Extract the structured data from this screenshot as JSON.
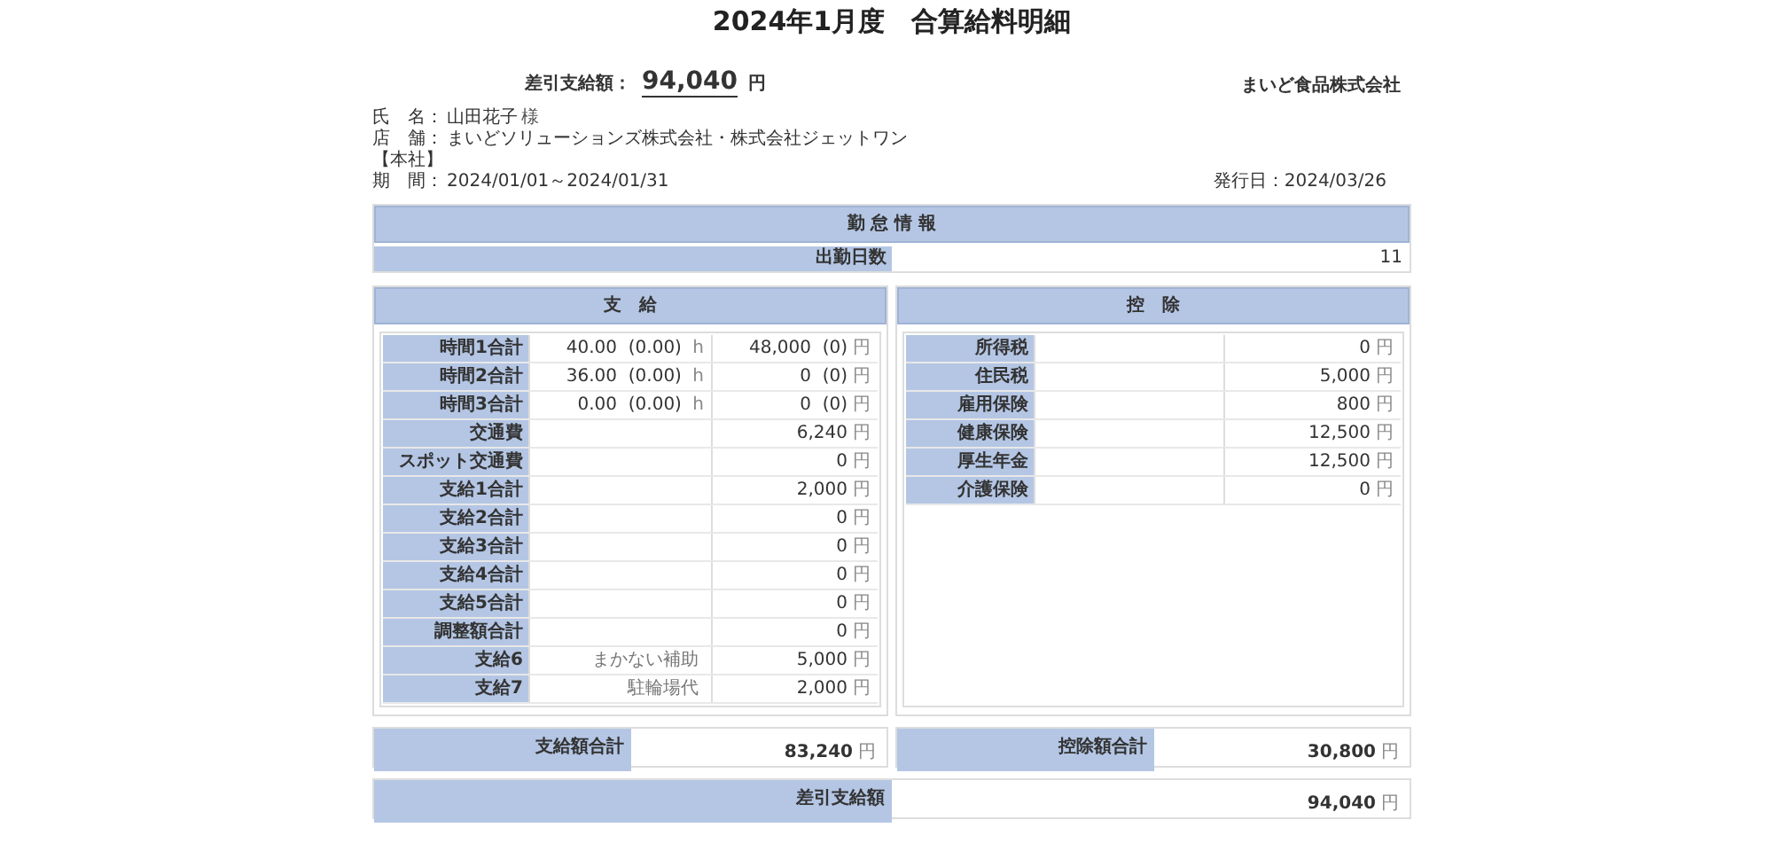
{
  "title": "2024年1月度　合算給料明細",
  "summary": {
    "label": "差引支給額：",
    "amount": "94,040",
    "unit": "円",
    "company": "まいど食品株式会社"
  },
  "info": {
    "name_label": "氏　名：",
    "name": "山田花子",
    "honorific": "様",
    "store_label": "店　舗：",
    "store": "まいどソリューションズ株式会社・株式会社ジェットワン",
    "branch": "【本社】",
    "period_label": "期　間：",
    "period": "2024/01/01～2024/01/31",
    "issued": "発行日：2024/03/26"
  },
  "attendance": {
    "title": "勤 怠 情 報",
    "rows": [
      {
        "label": "出勤日数",
        "value": "11"
      }
    ]
  },
  "payments": {
    "title": "支　給",
    "rows": [
      {
        "label": "時間1合計",
        "detail": "40.00  (0.00)",
        "detail_unit": "h",
        "amount": "48,000  (0)",
        "unit": "円"
      },
      {
        "label": "時間2合計",
        "detail": "36.00  (0.00)",
        "detail_unit": "h",
        "amount": "0  (0)",
        "unit": "円"
      },
      {
        "label": "時間3合計",
        "detail": "0.00  (0.00)",
        "detail_unit": "h",
        "amount": "0  (0)",
        "unit": "円"
      },
      {
        "label": "交通費",
        "amount": "6,240",
        "unit": "円"
      },
      {
        "label": "スポット交通費",
        "amount": "0",
        "unit": "円"
      },
      {
        "label": "支給1合計",
        "amount": "2,000",
        "unit": "円"
      },
      {
        "label": "支給2合計",
        "amount": "0",
        "unit": "円"
      },
      {
        "label": "支給3合計",
        "amount": "0",
        "unit": "円"
      },
      {
        "label": "支給4合計",
        "amount": "0",
        "unit": "円"
      },
      {
        "label": "支給5合計",
        "amount": "0",
        "unit": "円"
      },
      {
        "label": "調整額合計",
        "amount": "0",
        "unit": "円"
      },
      {
        "label": "支給6",
        "detail": "まかない補助",
        "amount": "5,000",
        "unit": "円"
      },
      {
        "label": "支給7",
        "detail": "駐輪場代",
        "amount": "2,000",
        "unit": "円"
      }
    ],
    "total_label": "支給額合計",
    "total": "83,240",
    "total_unit": "円"
  },
  "deductions": {
    "title": "控　除",
    "rows": [
      {
        "label": "所得税",
        "amount": "0",
        "unit": "円"
      },
      {
        "label": "住民税",
        "amount": "5,000",
        "unit": "円"
      },
      {
        "label": "雇用保険",
        "amount": "800",
        "unit": "円"
      },
      {
        "label": "健康保険",
        "amount": "12,500",
        "unit": "円"
      },
      {
        "label": "厚生年金",
        "amount": "12,500",
        "unit": "円"
      },
      {
        "label": "介護保険",
        "amount": "0",
        "unit": "円"
      }
    ],
    "total_label": "控除額合計",
    "total": "30,800",
    "total_unit": "円"
  },
  "net": {
    "label": "差引支給額",
    "amount": "94,040",
    "unit": "円"
  }
}
